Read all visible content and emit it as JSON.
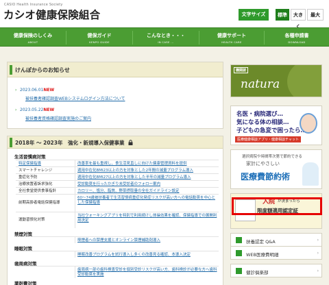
{
  "header": {
    "logo_en": "CASIO Health Insurance Society",
    "logo_ja": "カシオ健康保険組合",
    "font_size_label": "文字サイズ",
    "font_size_options": [
      "標準",
      "大きく",
      "最大"
    ]
  },
  "nav": [
    {
      "ja": "健康保険のしくみ",
      "en": "ABOUT"
    },
    {
      "ja": "健保ガイド",
      "en": "KENPO GUIDE"
    },
    {
      "ja": "こんなとき・・・",
      "en": "IN CASE ..."
    },
    {
      "ja": "健康サポート",
      "en": "HEALTH CARE"
    },
    {
      "ja": "各種申請書",
      "en": "DOWNLOAD"
    }
  ],
  "news": {
    "title": "けんぽからのお知らせ",
    "items": [
      {
        "date": "2023.06.01",
        "badge": "NEW",
        "text": "被扶養者確認調査WEBシステムログイン方法について"
      },
      {
        "date": "2023.05.22",
        "badge": "NEW",
        "text": "被扶養者資格確認調査実施のご案内"
      }
    ]
  },
  "health_plan": {
    "title": "2018年 ～ 2023年　強化・新規導入保健事業",
    "categories": [
      {
        "name": "生活習慣病対策",
        "rows": [
          {
            "name": "特定保健指導",
            "desc": "改善率を最も重視し、食生活見直しに向けた健康管理資料を提供"
          },
          {
            "name": "スマートチャレンジ",
            "desc": "適用中在化BMI23以上の方を対象とした2年間の減量プログラム導入"
          },
          {
            "name": "重症化予防",
            "desc": "適用中在化BMI27以上の方を対象とした半年の減量プログラム導入"
          },
          {
            "name": "治療放置者訴求強化",
            "desc": "受診勧奨を行ったかぎり未受診者のフォロー案内"
          },
          {
            "name": "全社食堂提供食事指針",
            "desc": "カロリー、塩分、脂質、野菜摂取量の全社ガイドライン設定"
          },
          {
            "name": "前期高齢者電話保健指導",
            "desc": "60～74歳被扶養者で生活習慣病重症化発症リスクが高い方への電話勧奨を中心とした保健指導"
          },
          {
            "name": "運動習慣化対策",
            "desc": "当社ウォーキングアプリを特別で利用続けし体操効果を確認、保健指導での展開利用決定"
          }
        ]
      },
      {
        "name": "禁煙対策",
        "rows": [
          {
            "name": "",
            "desc": "喫煙者への禁煙支援とオンライン禁煙補助剤導入"
          }
        ]
      },
      {
        "name": "睡眠対策",
        "rows": [
          {
            "name": "",
            "desc": "睡眠改善プログラムを試行導入し多くの改善見る確認、本導入決定"
          }
        ]
      },
      {
        "name": "歯周病対策",
        "rows": [
          {
            "name": "",
            "desc": "歯周病一部の歯科検査受診を個別受診リスクが高い方、歯科検診が必要な方へ歯科受診勧奨を実施"
          }
        ]
      },
      {
        "name": "薬剤費対策",
        "rows": []
      }
    ]
  },
  "sidebar": {
    "natura": {
      "tag": "機関誌",
      "word": "natura"
    },
    "banner_ai": {
      "l1": "名医・病院選び…",
      "l2": "気になる体の相談…",
      "l3": "子どもの急変で困ったら…",
      "l4": "医療健康相談アプリ・健康相談チャット"
    },
    "banner_med": {
      "l1": "選択病院や時間帯次第で節約できる",
      "l2": "家計にやさしい",
      "l3": "医療費節約術"
    },
    "banner_hosp": {
      "l1": "入院",
      "l2": "が決まったら",
      "l3": "限度額適用認定証"
    },
    "links": [
      {
        "label": "扶養認定 Q&A"
      },
      {
        "label": "WEB医療費明細"
      },
      {
        "label": "健診俱楽部"
      }
    ]
  },
  "colors": {
    "nav_green": "#4b9d33",
    "accent_red": "#e60000",
    "link_blue": "#1f6aa8"
  }
}
